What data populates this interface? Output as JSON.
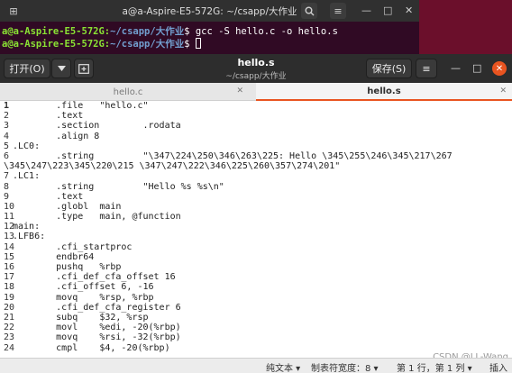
{
  "terminal": {
    "title": "a@a-Aspire-E5-572G: ~/csapp/大作业",
    "line1": {
      "user": "a@a-Aspire-E5-572G",
      "path": "~/csapp/大作业",
      "cmd": "$ gcc -S hello.c -o hello.s"
    },
    "line2": {
      "user": "a@a-Aspire-E5-572G",
      "path": "~/csapp/大作业",
      "cmd": "$ "
    }
  },
  "gedit": {
    "open_label": "打开(O)",
    "title": "hello.s",
    "subtitle": "~/csapp/大作业",
    "save_label": "保存(S)",
    "tabs": [
      {
        "label": "hello.c"
      },
      {
        "label": "hello.s"
      }
    ],
    "lines": [
      {
        "n": "1",
        "text": "        .file   \"hello.c\""
      },
      {
        "n": "2",
        "text": "        .text"
      },
      {
        "n": "3",
        "text": "        .section        .rodata"
      },
      {
        "n": "4",
        "text": "        .align 8"
      },
      {
        "n": "5",
        "text": ".LC0:"
      },
      {
        "n": "6",
        "text": "        .string         \"\\347\\224\\250\\346\\263\\225: Hello \\345\\255\\246\\345\\217\\267"
      },
      {
        "n": "",
        "text": "\\345\\247\\223\\345\\220\\215 \\347\\247\\222\\346\\225\\260\\357\\274\\201\""
      },
      {
        "n": "7",
        "text": ".LC1:"
      },
      {
        "n": "8",
        "text": "        .string         \"Hello %s %s\\n\""
      },
      {
        "n": "9",
        "text": "        .text"
      },
      {
        "n": "10",
        "text": "        .globl  main"
      },
      {
        "n": "11",
        "text": "        .type   main, @function"
      },
      {
        "n": "12",
        "text": "main:"
      },
      {
        "n": "13",
        "text": ".LFB6:"
      },
      {
        "n": "14",
        "text": "        .cfi_startproc"
      },
      {
        "n": "15",
        "text": "        endbr64"
      },
      {
        "n": "16",
        "text": "        pushq   %rbp"
      },
      {
        "n": "17",
        "text": "        .cfi_def_cfa_offset 16"
      },
      {
        "n": "18",
        "text": "        .cfi_offset 6, -16"
      },
      {
        "n": "19",
        "text": "        movq    %rsp, %rbp"
      },
      {
        "n": "20",
        "text": "        .cfi_def_cfa_register 6"
      },
      {
        "n": "21",
        "text": "        subq    $32, %rsp"
      },
      {
        "n": "22",
        "text": "        movl    %edi, -20(%rbp)"
      },
      {
        "n": "23",
        "text": "        movq    %rsi, -32(%rbp)"
      },
      {
        "n": "24",
        "text": "        cmpl    $4, -20(%rbp)"
      }
    ],
    "watermark": "CSDN @LL-Wang",
    "status": {
      "lang": "纯文本 ▾",
      "tab_width": "制表符宽度：8 ▾",
      "position": "第 1 行，第 1 列 ▾",
      "mode": "插入"
    }
  }
}
